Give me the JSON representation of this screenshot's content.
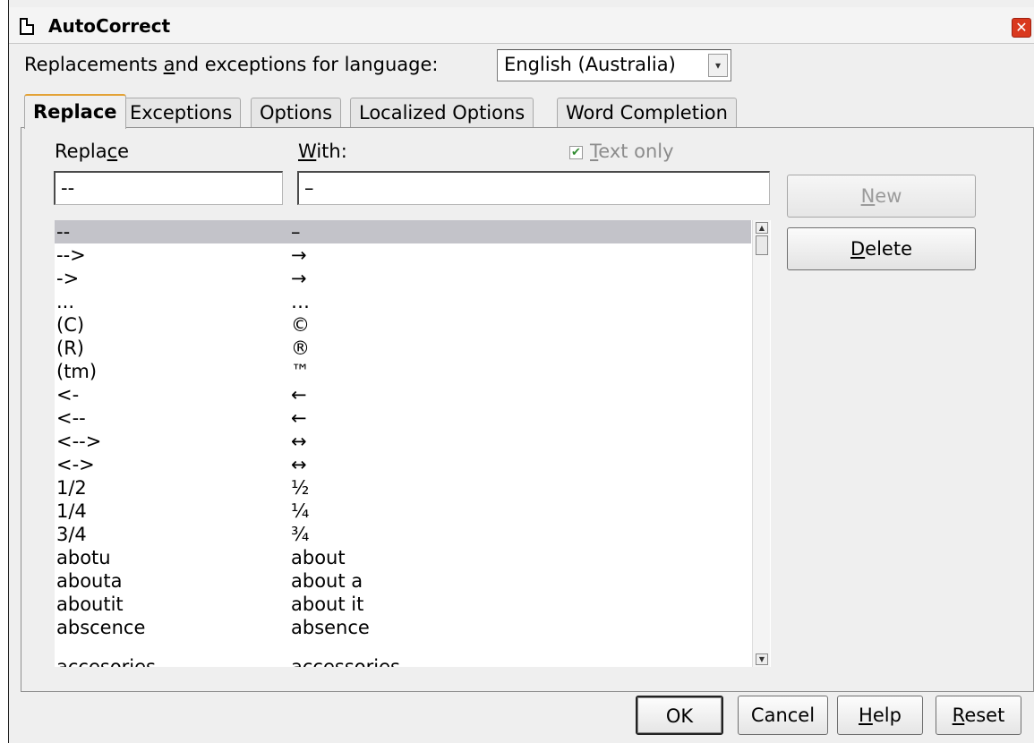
{
  "window": {
    "title": "AutoCorrect"
  },
  "language": {
    "label_pre": "Replacements ",
    "label_key": "a",
    "label_post": "nd exceptions for language:",
    "value": "English (Australia)"
  },
  "tabs": [
    "Replace",
    "Exceptions",
    "Options",
    "Localized Options",
    "Word Completion"
  ],
  "replace": {
    "replace_label_pre": "Repla",
    "replace_label_key": "c",
    "replace_label_post": "e",
    "with_label_key": "W",
    "with_label_post": "ith:",
    "text_only_key": "T",
    "text_only_post": "ext only",
    "text_only_checked": true,
    "replace_value": "--",
    "with_value": "–"
  },
  "buttons": {
    "new_key": "N",
    "new_post": "ew",
    "delete_key": "D",
    "delete_post": "elete"
  },
  "entries": [
    {
      "replace": "--",
      "with": "–"
    },
    {
      "replace": "-->",
      "with": "→"
    },
    {
      "replace": "->",
      "with": "→"
    },
    {
      "replace": "...",
      "with": "…"
    },
    {
      "replace": "(C)",
      "with": "©"
    },
    {
      "replace": "(R)",
      "with": "®"
    },
    {
      "replace": "(tm)",
      "with": "™"
    },
    {
      "replace": "<-",
      "with": "←"
    },
    {
      "replace": "<--",
      "with": "←"
    },
    {
      "replace": "<-->",
      "with": "↔"
    },
    {
      "replace": "<->",
      "with": "↔"
    },
    {
      "replace": "1/2",
      "with": "½"
    },
    {
      "replace": "1/4",
      "with": "¼"
    },
    {
      "replace": "3/4",
      "with": "¾"
    },
    {
      "replace": "abotu",
      "with": "about"
    },
    {
      "replace": "abouta",
      "with": "about a"
    },
    {
      "replace": "aboutit",
      "with": "about it"
    },
    {
      "replace": "abscence",
      "with": "absence"
    },
    {
      "replace": "accesories",
      "with": "accessories"
    }
  ],
  "footer": {
    "ok": "OK",
    "cancel": "Cancel",
    "help_key": "H",
    "help_post": "elp",
    "reset_key": "R",
    "reset_post": "eset"
  }
}
